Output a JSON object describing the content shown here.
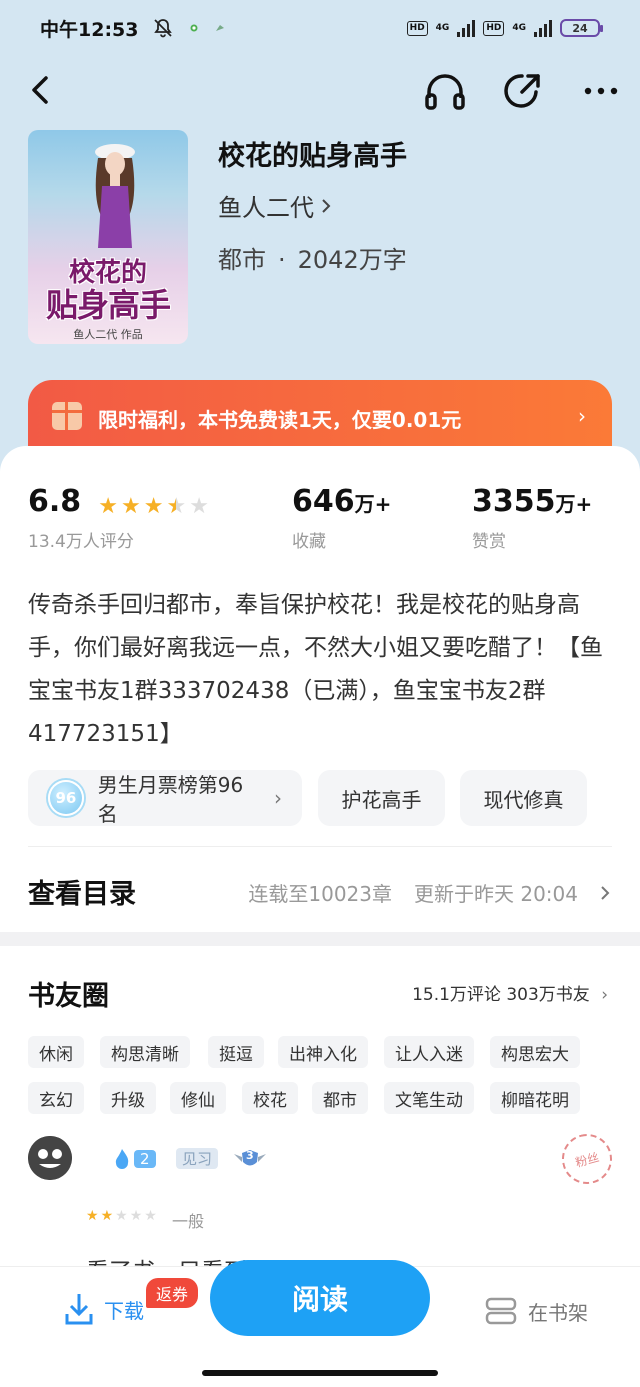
{
  "status_bar": {
    "time": "中午12:53",
    "hd1": "HD",
    "net1": "4G",
    "hd2": "HD",
    "net2": "4G",
    "battery": "24"
  },
  "book": {
    "title": "校花的贴身高手",
    "author": "鱼人二代",
    "genre": "都市",
    "separator": "·",
    "word_count": "2042万字",
    "cover": {
      "title_line1": "校花的",
      "title_line2": "贴身高手",
      "author_line": "鱼人二代 作品"
    }
  },
  "promo": {
    "text": "限时福利，本书免费读1天，仅要0.01元"
  },
  "stats": {
    "rating": "6.8",
    "rating_stars": 3.5,
    "rating_count": "13.4万人评分",
    "favorites": "646",
    "favorites_unit": "万+",
    "favorites_label": "收藏",
    "rewards": "3355",
    "rewards_unit": "万+",
    "rewards_label": "赞赏"
  },
  "description": "传奇杀手回归都市，奉旨保护校花！我是校花的贴身高手，你们最好离我远一点，不然大小姐又要吃醋了！【鱼宝宝书友1群333702438（已满），鱼宝宝书友2群417723151】",
  "chips": {
    "rank_number": "96",
    "rank_text": "男生月票榜第96名",
    "tag1": "护花高手",
    "tag2": "现代修真"
  },
  "toc": {
    "title": "查看目录",
    "serial": "连载至10023章",
    "updated": "更新于昨天 20:04"
  },
  "circle": {
    "title": "书友圈",
    "info": "15.1万评论 303万书友",
    "tags": [
      "休闲",
      "构思清晰",
      "挺逗",
      "出神入化",
      "让人入迷",
      "构思宏大",
      "玄幻",
      "升级",
      "修仙",
      "校花",
      "都市",
      "文笔生动",
      "柳暗花明"
    ]
  },
  "review": {
    "fan_level": "2",
    "badge": "见习",
    "shield_level": "3",
    "stamp_text": "粉丝",
    "stars": 2,
    "label": "一般",
    "peek": "看了书，只看到..."
  },
  "bottom_bar": {
    "download": "下载",
    "fanquan": "返券",
    "read": "阅读",
    "shelf": "在书架"
  },
  "colors": {
    "header_bg": "#d4e6f2",
    "promo_start": "#f25a45",
    "promo_end": "#fb7a37",
    "primary_blue": "#1ea1f5",
    "star": "#f6b026",
    "fanquan_red": "#f0493a"
  }
}
